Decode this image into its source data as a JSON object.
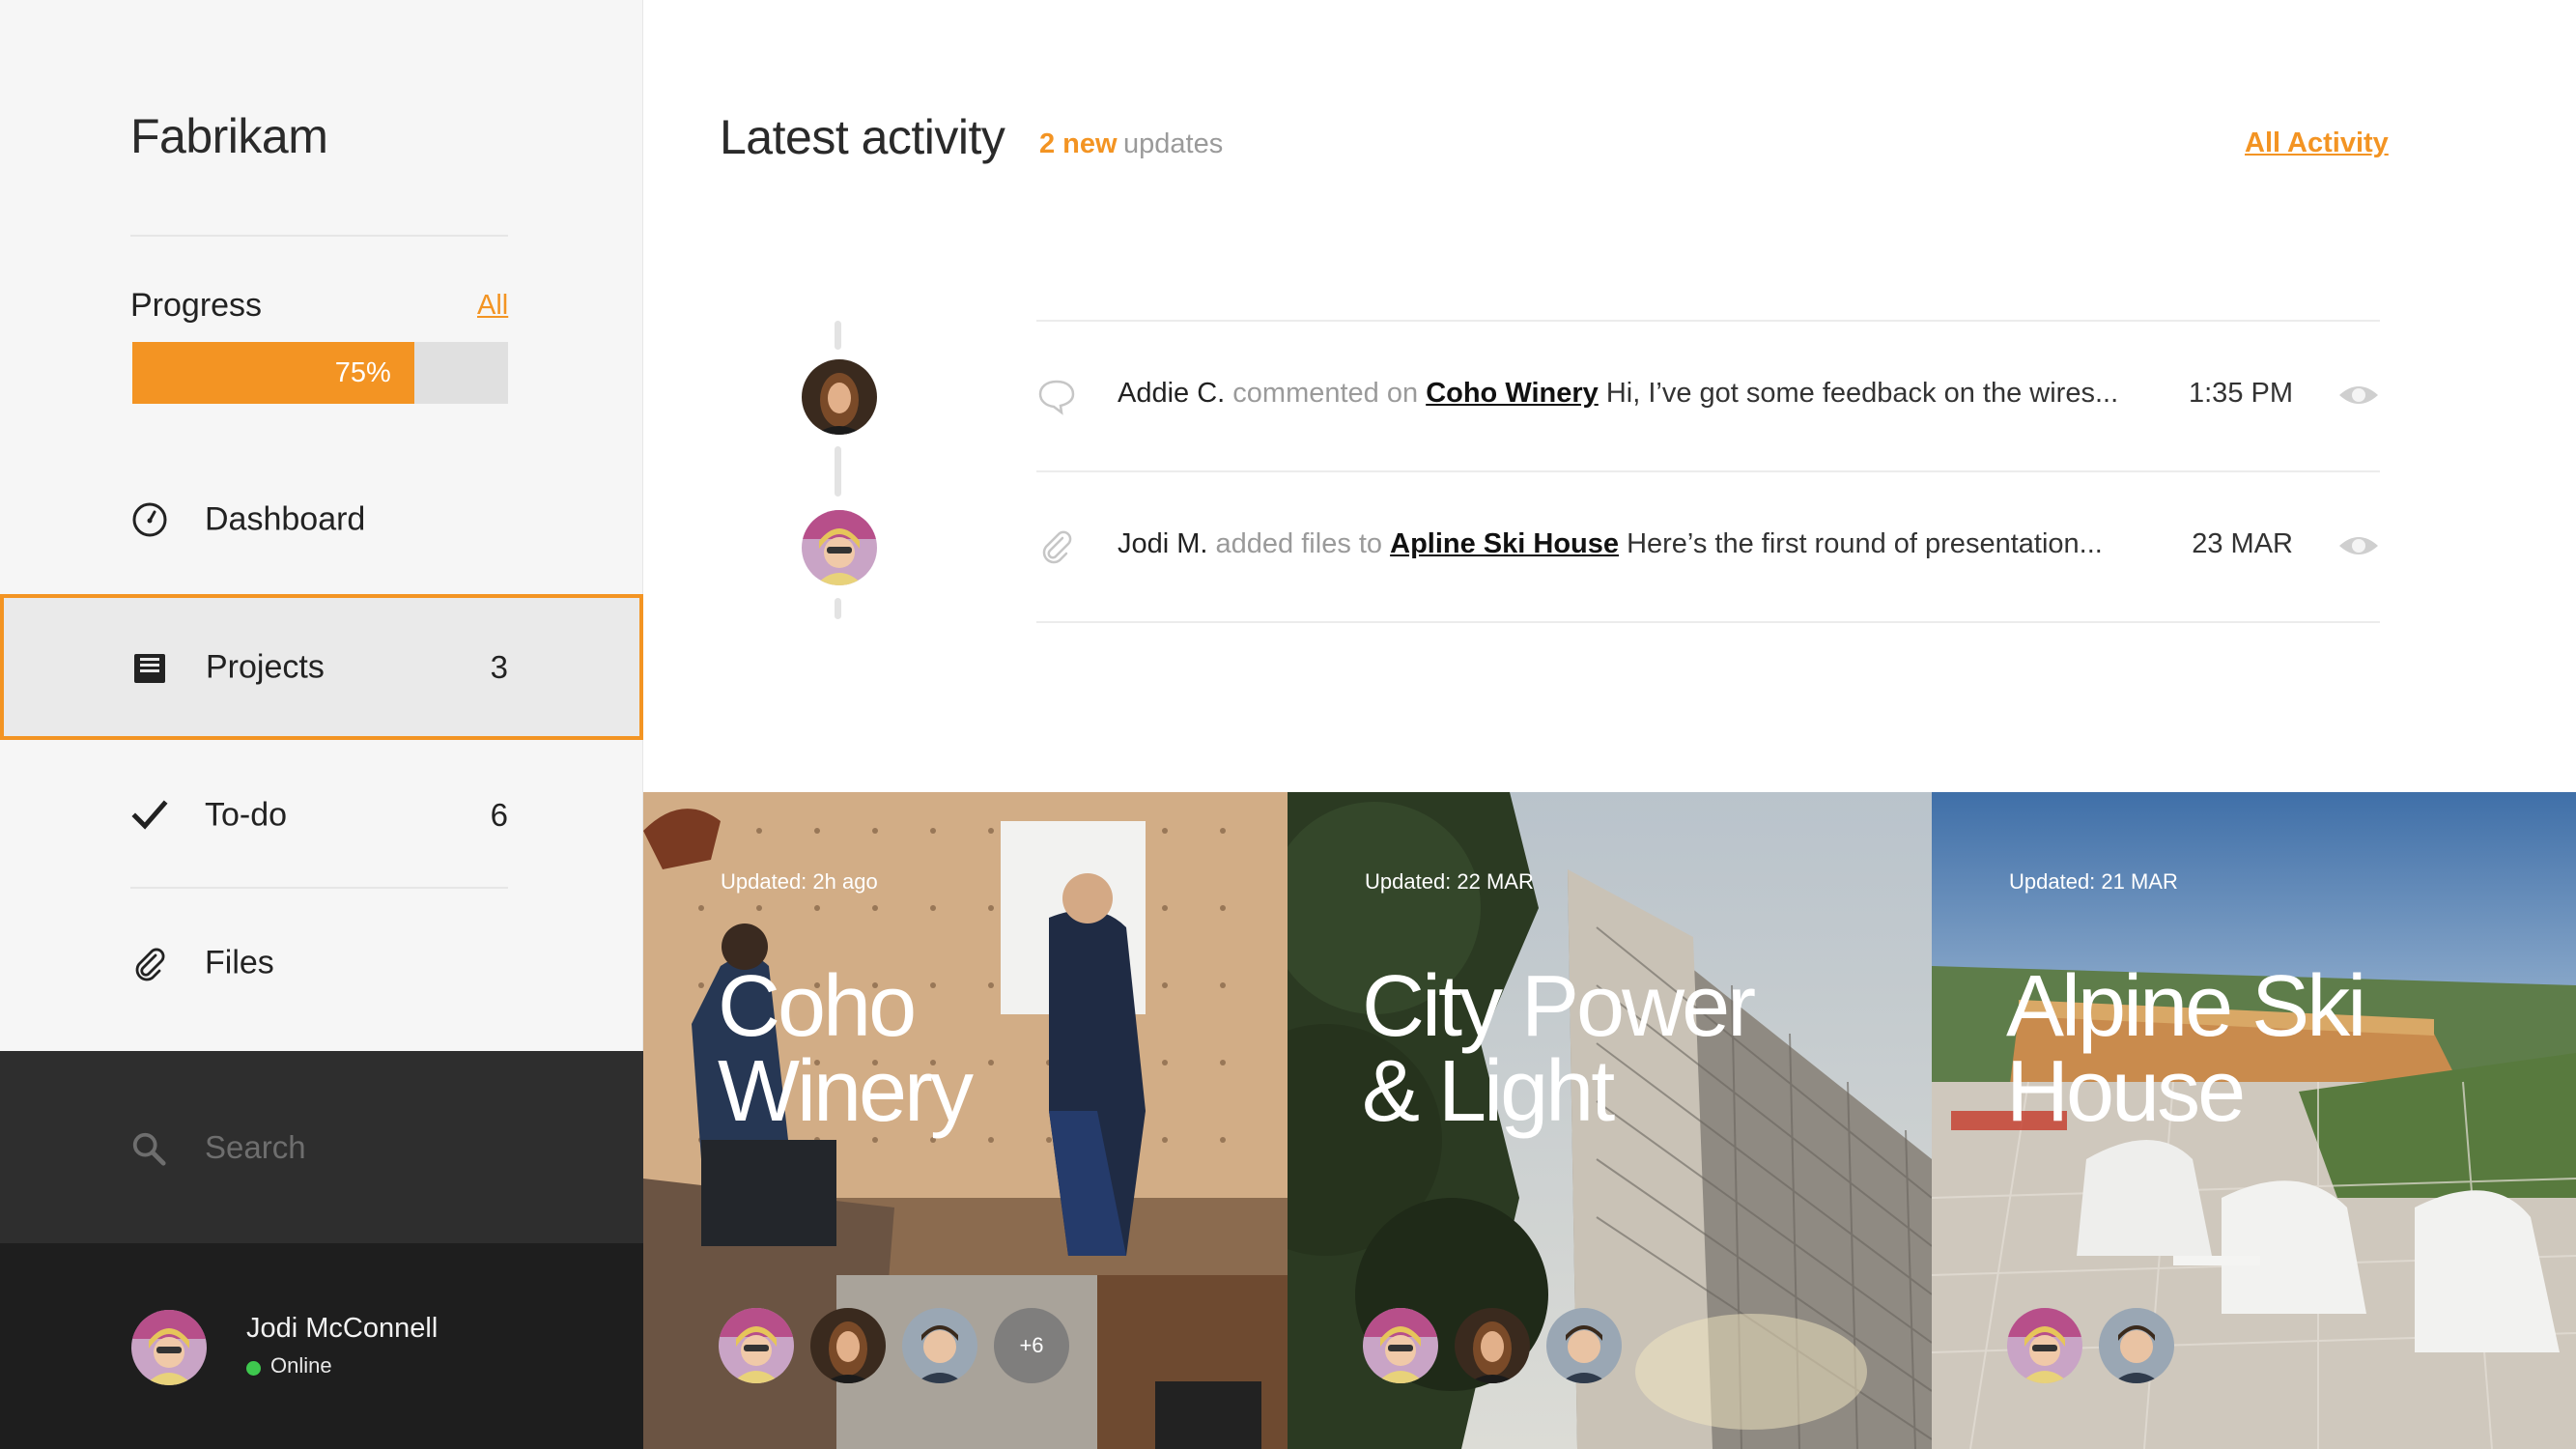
{
  "sidebar": {
    "brand": "Fabrikam",
    "progress": {
      "label": "Progress",
      "link": "All",
      "value": 0.75,
      "value_text": "75%"
    },
    "nav": [
      {
        "label": "Dashboard",
        "icon": "dashboard-icon",
        "count": ""
      },
      {
        "label": "Projects",
        "icon": "projects-icon",
        "count": "3"
      },
      {
        "label": "To-do",
        "icon": "checkmark-icon",
        "count": "6"
      },
      {
        "label": "Files",
        "icon": "paperclip-icon",
        "count": ""
      }
    ],
    "search": {
      "placeholder": "Search",
      "icon": "search-icon"
    },
    "user": {
      "name": "Jodi McConnell",
      "status": "Online",
      "status_color": "#3ec84e"
    }
  },
  "main": {
    "title": "Latest activity",
    "new_count": "2 new",
    "new_suffix": "updates",
    "all_activity": "All Activity",
    "activity": [
      {
        "who": "Addie C.",
        "verb": "commented on",
        "target": "Coho Winery",
        "message": "Hi, I’ve got some feedback on the wires...",
        "time": "1:35 PM",
        "type_icon": "comment-icon"
      },
      {
        "who": "Jodi M.",
        "verb": "added files to",
        "target": "Apline Ski House",
        "message": "Here’s the first round of presentation...",
        "time": "23 MAR",
        "type_icon": "paperclip-icon"
      }
    ]
  },
  "projects": [
    {
      "updated": "Updated: 2h ago",
      "title_line1": "Coho",
      "title_line2": "Winery",
      "extra_members": "+6"
    },
    {
      "updated": "Updated: 22 MAR",
      "title_line1": "City Power",
      "title_line2": "& Light"
    },
    {
      "updated": "Updated: 21 MAR",
      "title_line1": "Alpine Ski",
      "title_line2": "House"
    }
  ],
  "colors": {
    "accent": "#f39423",
    "sidebar_bg": "#f6f6f6",
    "search_bg": "#2e2e2e",
    "user_bg": "#1e1e1e"
  }
}
